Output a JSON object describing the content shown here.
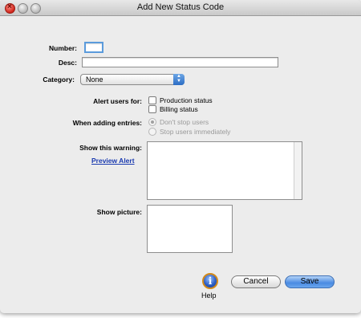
{
  "window": {
    "title": "Add New Status Code"
  },
  "form": {
    "number_label": "Number:",
    "number_value": "",
    "desc_label": "Desc:",
    "desc_value": "",
    "category_label": "Category:",
    "category_value": "None",
    "alert_label": "Alert users for:",
    "alert_options": [
      {
        "label": "Production status",
        "checked": false
      },
      {
        "label": "Billing status",
        "checked": false
      }
    ],
    "adding_label": "When adding entries:",
    "adding_options": [
      {
        "label": "Don't stop users",
        "selected": true,
        "disabled": true
      },
      {
        "label": "Stop users immediately",
        "selected": false,
        "disabled": true
      }
    ],
    "warning_label": "Show this warning:",
    "preview_link": "Preview Alert",
    "picture_label": "Show  picture:"
  },
  "footer": {
    "help_label": "Help",
    "help_glyph": "i",
    "cancel_label": "Cancel",
    "save_label": "Save"
  },
  "colors": {
    "accent": "#4a8be2",
    "link": "#1b3bb0",
    "help_ring": "#d38a1a"
  }
}
